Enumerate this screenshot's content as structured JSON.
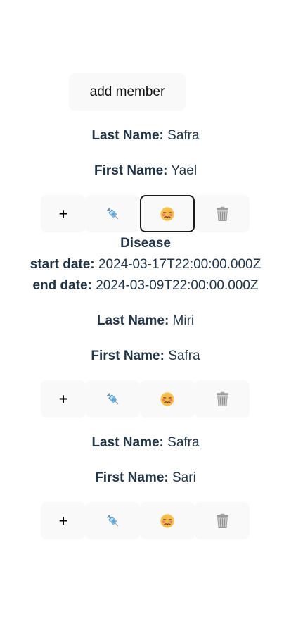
{
  "header": {
    "add_member_label": "add member"
  },
  "labels": {
    "last_name": "Last Name:",
    "first_name": "First Name:",
    "add_action": "+",
    "disease_title": "Disease",
    "start_date": "start date:",
    "end_date": "end date:"
  },
  "icons": {
    "vaccine": "syringe-icon",
    "disease": "sick-face-icon",
    "delete": "trash-icon"
  },
  "members": [
    {
      "last_name": "Safra",
      "first_name": "Yael",
      "disease": {
        "start_date": "2024-03-17T22:00:00.000Z",
        "end_date": "2024-03-09T22:00:00.000Z"
      }
    },
    {
      "last_name": "Miri",
      "first_name": "Safra"
    },
    {
      "last_name": "Safra",
      "first_name": "Sari"
    }
  ]
}
